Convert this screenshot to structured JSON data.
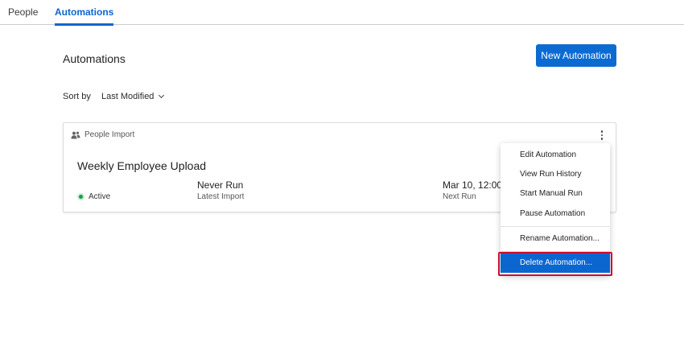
{
  "tabs": [
    {
      "label": "People",
      "active": false
    },
    {
      "label": "Automations",
      "active": true
    }
  ],
  "page_title": "Automations",
  "new_button_label": "New Automation",
  "sort": {
    "label": "Sort by",
    "value": "Last Modified"
  },
  "card": {
    "type_label": "People Import",
    "name": "Weekly Employee Upload",
    "status": "Active",
    "latest_import_value": "Never Run",
    "latest_import_label": "Latest Import",
    "next_run_value": "Mar 10, 12:00",
    "next_run_label": "Next Run"
  },
  "menu": {
    "items": [
      "Edit Automation",
      "View Run History",
      "Start Manual Run",
      "Pause Automation",
      "Rename Automation...",
      "Delete Automation..."
    ]
  },
  "colors": {
    "accent": "#0b66d0",
    "status_active": "#1a9e4b",
    "highlight_border": "#c8102e"
  }
}
